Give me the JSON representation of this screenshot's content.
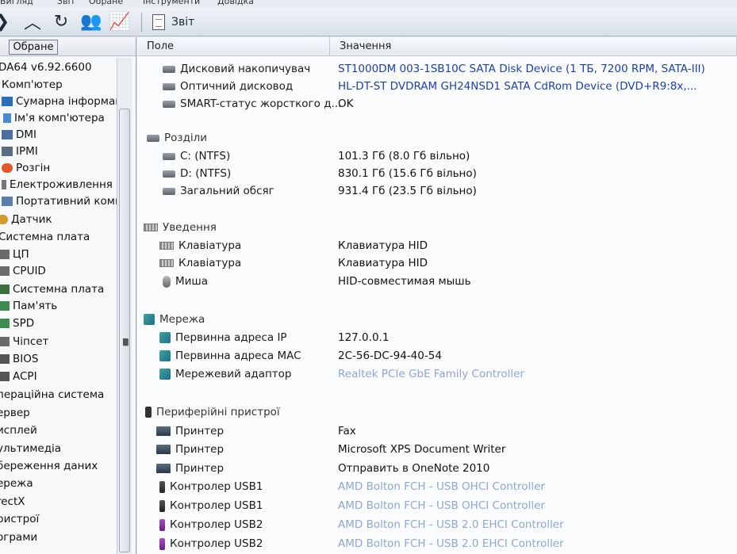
{
  "menubar": {
    "items": [
      "Вигляд",
      "Звіт",
      "Обране",
      "Інструменти",
      "Довідка"
    ]
  },
  "toolbar": {
    "report_label": "Звіт"
  },
  "left_panel": {
    "favorites_label": "Обране",
    "items": [
      "DA64 v6.92.6600",
      "Комп'ютер",
      "Сумарна інформац",
      "Ім'я комп'ютера",
      "DMI",
      "IPMI",
      "Розгін",
      "Електроживлення",
      "Портативний комп",
      "Датчик",
      "Системна плата",
      "ЦП",
      "CPUID",
      "Системна плата",
      "Пам'ять",
      "SPD",
      "Чіпсет",
      "BIOS",
      "ACPI",
      "пераційна система",
      "ервер",
      "исплей",
      "ультимедіа",
      "береження даних",
      "ережа",
      "rectX",
      "ристрої",
      "ограми"
    ]
  },
  "columns": {
    "field": "Поле",
    "value": "Значення"
  },
  "rows": [
    {
      "field": "Дисковий накопичувач",
      "value": "ST1000DM 003-1SB10C SATA Disk Device  (1 ТБ, 7200 RPM, SATA-III)"
    },
    {
      "field": "Оптичний дисковод",
      "value": "HL-DT-ST DVDRAM GH24NSD1 SATA CdRom Device  (DVD+R9:8x,..."
    },
    {
      "field": "SMART-статус жорсткого д...",
      "value": "OK"
    },
    {
      "field": "Розділи",
      "value": ""
    },
    {
      "field": "C: (NTFS)",
      "value": "101.3 Гб (8.0 Гб вільно)"
    },
    {
      "field": "D: (NTFS)",
      "value": "830.1 Гб (15.6 Гб вільно)"
    },
    {
      "field": "Загальний обсяг",
      "value": "931.4 Гб (23.5 Гб вільно)"
    },
    {
      "field": "Уведення",
      "value": ""
    },
    {
      "field": "Клавіатура",
      "value": "Клавиатура HID"
    },
    {
      "field": "Клавіатура",
      "value": "Клавиатура HID"
    },
    {
      "field": "Миша",
      "value": "HID-совместимая мышь"
    },
    {
      "field": "Мережа",
      "value": ""
    },
    {
      "field": "Первинна адреса IP",
      "value": "127.0.0.1"
    },
    {
      "field": "Первинна адреса MAC",
      "value": "2C-56-DC-94-40-54"
    },
    {
      "field": "Мережевий адаптор",
      "value": "Realtek PCIe GbE Family Controller"
    },
    {
      "field": "Периферійні пристрої",
      "value": ""
    },
    {
      "field": "Принтер",
      "value": "Fax"
    },
    {
      "field": "Принтер",
      "value": "Microsoft XPS Document Writer"
    },
    {
      "field": "Принтер",
      "value": "Отправить в OneNote 2010"
    },
    {
      "field": "Контролер USB1",
      "value": "AMD Bolton FCH - USB OHCI Controller"
    },
    {
      "field": "Контролер USB1",
      "value": "AMD Bolton FCH - USB OHCI Controller"
    },
    {
      "field": "Контролер USB2",
      "value": "AMD Bolton FCH - USB 2.0 EHCI Controller"
    },
    {
      "field": "Контролер USB2",
      "value": "AMD Bolton FCH - USB 2.0 EHCI Controller"
    }
  ],
  "colors": {
    "link": "#1a3fb4",
    "link_faint": "#8ea6d6",
    "toolbar_bg": "#dde3ea"
  }
}
